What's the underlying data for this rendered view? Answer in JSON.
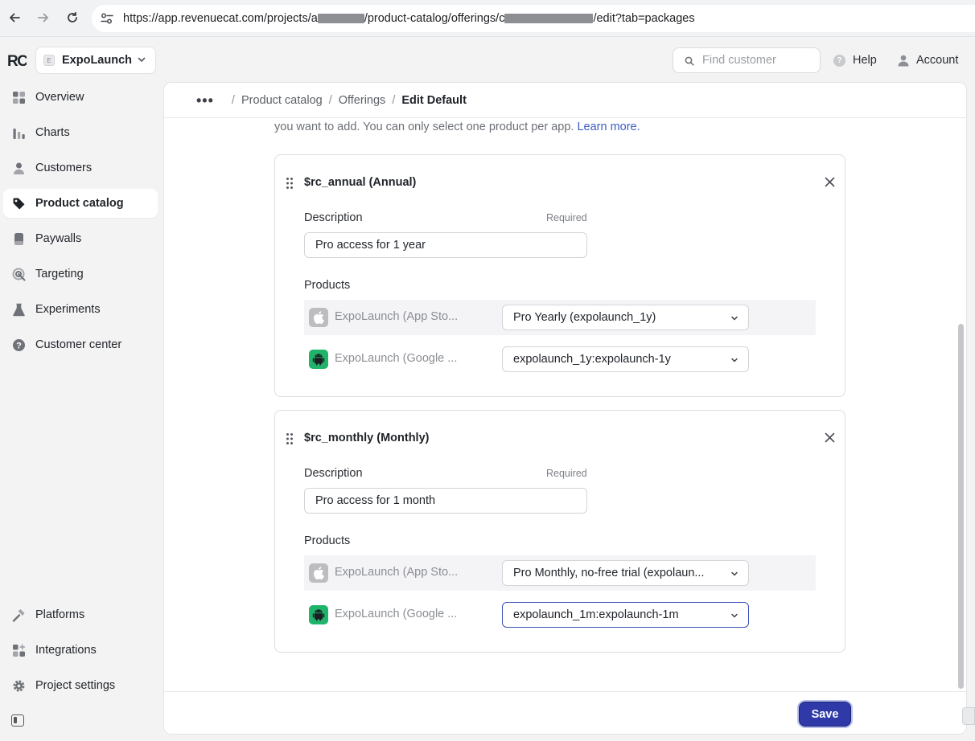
{
  "browser": {
    "url_prefix": "https://app.revenuecat.com/projects/a",
    "url_middle": "/product-catalog/offerings/c",
    "url_suffix": "/edit?tab=packages"
  },
  "header": {
    "logo_text": "RC",
    "project_badge": "E",
    "project_name": "ExpoLaunch",
    "search_placeholder": "Find customer",
    "help_label": "Help",
    "account_label": "Account"
  },
  "sidebar": {
    "items": [
      {
        "label": "Overview",
        "icon": "overview-icon"
      },
      {
        "label": "Charts",
        "icon": "charts-icon"
      },
      {
        "label": "Customers",
        "icon": "customers-icon"
      },
      {
        "label": "Product catalog",
        "icon": "tag-icon",
        "active": true
      },
      {
        "label": "Paywalls",
        "icon": "paywalls-icon"
      },
      {
        "label": "Targeting",
        "icon": "targeting-icon"
      },
      {
        "label": "Experiments",
        "icon": "flask-icon"
      },
      {
        "label": "Customer center",
        "icon": "help-circle-icon"
      }
    ],
    "bottom_items": [
      {
        "label": "Platforms",
        "icon": "hammer-icon"
      },
      {
        "label": "Integrations",
        "icon": "integrations-icon"
      },
      {
        "label": "Project settings",
        "icon": "gear-icon"
      }
    ]
  },
  "breadcrumb": {
    "items": [
      "Product catalog",
      "Offerings"
    ],
    "current": "Edit Default"
  },
  "intro": {
    "text": "you want to add. You can only select one product per app.",
    "link": "Learn more."
  },
  "packages": [
    {
      "title": "$rc_annual (Annual)",
      "description_label": "Description",
      "required_label": "Required",
      "description_value": "Pro access for 1 year",
      "products_label": "Products",
      "products": [
        {
          "store": "apple",
          "app": "ExpoLaunch (App Sto...",
          "selected": "Pro Yearly (expolaunch_1y)"
        },
        {
          "store": "android",
          "app": "ExpoLaunch (Google ...",
          "selected": "expolaunch_1y:expolaunch-1y"
        }
      ]
    },
    {
      "title": "$rc_monthly (Monthly)",
      "description_label": "Description",
      "required_label": "Required",
      "description_value": "Pro access for 1 month",
      "products_label": "Products",
      "products": [
        {
          "store": "apple",
          "app": "ExpoLaunch (App Sto...",
          "selected": "Pro Monthly, no-free trial (expolaun..."
        },
        {
          "store": "android",
          "app": "ExpoLaunch (Google ...",
          "selected": "expolaunch_1m:expolaunch-1m"
        }
      ]
    }
  ],
  "footer": {
    "save_label": "Save"
  },
  "colors": {
    "accent": "#2f3aa8",
    "link": "#3c5cc7",
    "android": "#20b36a"
  }
}
